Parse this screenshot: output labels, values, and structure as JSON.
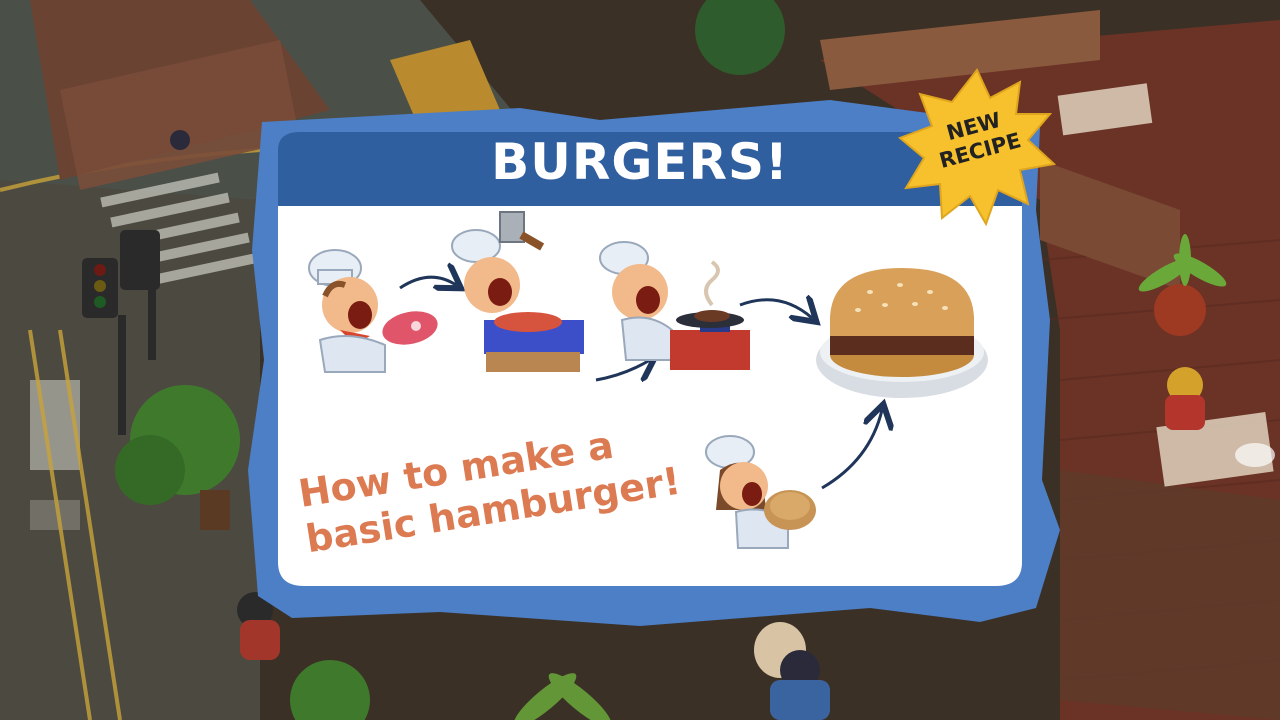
{
  "recipe_card": {
    "title": "BURGERS!",
    "tagline_line1": "How to make a",
    "tagline_line2": "basic hamburger!"
  },
  "badge": {
    "line1": "NEW",
    "line2": "RECIPE",
    "color": "#f6c12c"
  },
  "colors": {
    "frame_blue": "#4c7fc6",
    "header_blue": "#2f5f9e",
    "card_white": "#ffffff",
    "tagline_orange": "#dc7a52",
    "arrow_navy": "#1f3559"
  },
  "steps": [
    {
      "name": "chef-with-raw-meat"
    },
    {
      "name": "chef-tenderizing-meat"
    },
    {
      "name": "chef-cooking-patty"
    },
    {
      "name": "finished-burger"
    },
    {
      "name": "chef-with-bun"
    }
  ],
  "background": {
    "description_icons": [
      "street-scene",
      "restaurant-floor",
      "traffic-light",
      "trees",
      "plant-pot"
    ]
  }
}
